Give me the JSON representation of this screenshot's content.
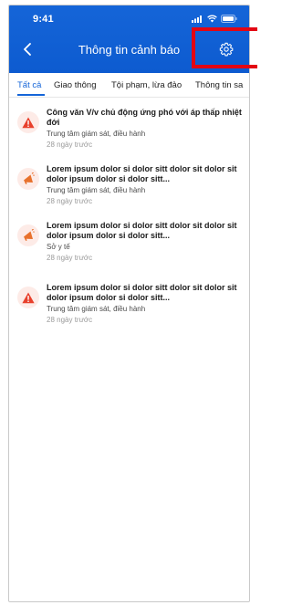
{
  "status_bar": {
    "time": "9:41"
  },
  "header": {
    "title": "Thông tin cảnh báo"
  },
  "tabs": [
    {
      "label": "Tất cả"
    },
    {
      "label": "Giao thông"
    },
    {
      "label": "Tội phạm, lừa đảo"
    },
    {
      "label": "Thông tin sa"
    }
  ],
  "alerts": [
    {
      "icon": "warning-triangle-icon",
      "title": "Công văn V/v chủ động ứng phó với áp thấp nhiệt đới",
      "source": "Trung tâm giám sát, điều hành",
      "time": "28 ngày trước"
    },
    {
      "icon": "megaphone-icon",
      "title": "Lorem ipsum dolor si dolor sitt  dolor sit dolor sit dolor ipsum dolor si dolor sitt...",
      "source": "Trung tâm giám sát, điều hành",
      "time": "28 ngày trước"
    },
    {
      "icon": "megaphone-icon",
      "title": "Lorem ipsum dolor si dolor sitt  dolor sit dolor sit dolor ipsum dolor si dolor sitt...",
      "source": "Sở y tế",
      "time": "28 ngày trước"
    },
    {
      "icon": "warning-triangle-icon",
      "title": "Lorem ipsum dolor si dolor sitt  dolor sit dolor sit dolor ipsum dolor si dolor sitt...",
      "source": "Trung tâm giám sát, điều hành",
      "time": "28 ngày trước"
    }
  ],
  "colors": {
    "header_blue": "#1565d8",
    "alert_red": "#e8402c",
    "icon_bg": "#fdebe7",
    "highlight_box": "#e30613"
  }
}
